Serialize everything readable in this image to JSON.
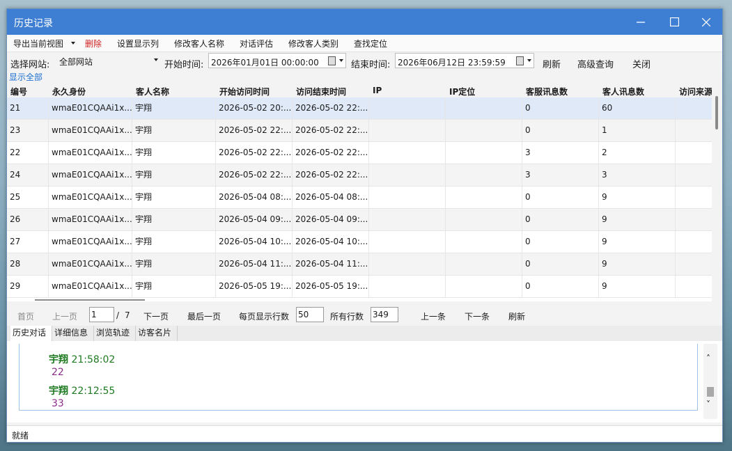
{
  "window": {
    "title": "历史记录"
  },
  "menu": {
    "export": "导出当前视图",
    "delete": "删除",
    "columns": "设置显示列",
    "rename": "修改客人名称",
    "evaluate": "对话评估",
    "change_type": "修改客人类别",
    "locate": "查找定位"
  },
  "query": {
    "site_label": "选择网站:",
    "site_value": "全部网站",
    "start_label": "开始时间:",
    "start_value": "2026年01月01日 00:00:00",
    "end_label": "结束时间:",
    "end_value": "2026年06月12日 23:59:59",
    "refresh": "刷新",
    "advanced": "高级查询",
    "close": "关闭"
  },
  "show_all": "显示全部",
  "table": {
    "headers": [
      "编号",
      "永久身份",
      "客人名称",
      "开始访问时间",
      "访问结束时间",
      "IP",
      "IP定位",
      "客服讯息数",
      "客人讯息数",
      "访问来源"
    ],
    "rows": [
      [
        "21",
        "wmaE01CQAAi1x...",
        "宇翔",
        "2026-05-02 20:...",
        "2026-05-02 22:...",
        "",
        "",
        "0",
        "60",
        ""
      ],
      [
        "23",
        "wmaE01CQAAi1x...",
        "宇翔",
        "2026-05-02 22:...",
        "2026-05-02 22:...",
        "",
        "",
        "0",
        "1",
        ""
      ],
      [
        "22",
        "wmaE01CQAAi1x...",
        "宇翔",
        "2026-05-02 22:...",
        "2026-05-02 22:...",
        "",
        "",
        "3",
        "2",
        ""
      ],
      [
        "24",
        "wmaE01CQAAi1x...",
        "宇翔",
        "2026-05-02 22:...",
        "2026-05-02 22:...",
        "",
        "",
        "3",
        "3",
        ""
      ],
      [
        "25",
        "wmaE01CQAAi1x...",
        "宇翔",
        "2026-05-04 08:...",
        "2026-05-04 08:...",
        "",
        "",
        "0",
        "9",
        ""
      ],
      [
        "26",
        "wmaE01CQAAi1x...",
        "宇翔",
        "2026-05-04 09:...",
        "2026-05-04 09:...",
        "",
        "",
        "0",
        "9",
        ""
      ],
      [
        "27",
        "wmaE01CQAAi1x...",
        "宇翔",
        "2026-05-04 10:...",
        "2026-05-04 10:...",
        "",
        "",
        "0",
        "9",
        ""
      ],
      [
        "28",
        "wmaE01CQAAi1x...",
        "宇翔",
        "2026-05-04 11:...",
        "2026-05-04 11:...",
        "",
        "",
        "0",
        "9",
        ""
      ],
      [
        "29",
        "wmaE01CQAAi1x...",
        "宇翔",
        "2026-05-05 19:...",
        "2026-05-05 19:...",
        "",
        "",
        "0",
        "9",
        ""
      ]
    ]
  },
  "pager": {
    "first": "首页",
    "prev": "上一页",
    "page": "1",
    "slash": "/",
    "total_pages": "7",
    "next": "下一页",
    "last": "最后一页",
    "rows_per_page_label": "每页显示行数",
    "rows_per_page": "50",
    "total_rows_label": "所有行数",
    "total_rows": "349",
    "prev_item": "上一条",
    "next_item": "下一条",
    "refresh": "刷新"
  },
  "tabs": [
    "历史对话",
    "详细信息",
    "浏览轨迹",
    "访客名片"
  ],
  "chat": [
    {
      "name": "宇翔",
      "time": "21:58:02",
      "text": "22"
    },
    {
      "name": "宇翔",
      "time": "22:12:55",
      "text": "33"
    }
  ],
  "status": "就绪"
}
